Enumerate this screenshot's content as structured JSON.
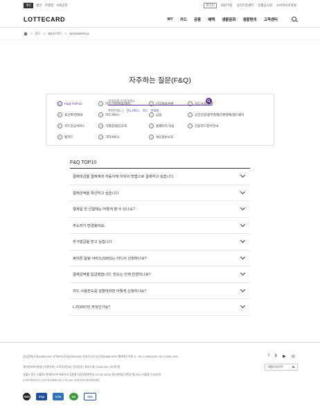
{
  "topbar": {
    "left": [
      "개인",
      "법인",
      "가맹점",
      "사회공헌"
    ],
    "right_box": "로그인",
    "right": [
      "회원가입",
      "공인인증센터",
      "상품공시실",
      "소비자보호포털"
    ]
  },
  "header": {
    "logo": "LOTTECARD",
    "menu": [
      "MY",
      "카드",
      "금융",
      "혜택",
      "생활문화",
      "생활편의",
      "고객센터"
    ]
  },
  "breadcrumb": [
    "카드",
    "BEST카드",
    "WONDERFUL"
  ],
  "page_title": "자주하는 질문(F&Q)",
  "search": {
    "placeholder": "검색어를 입력하세요."
  },
  "recommend": {
    "label": "추천키워드 |",
    "keywords": [
      "한도서비스",
      "카드",
      "연회비"
    ]
  },
  "categories": [
    "F&Q TOP10",
    "카드신청/발급/해지",
    "신상정보변경",
    "카드사용/결제",
    "포인트/연회비",
    "카드서비스",
    "금융",
    "공인인증/할부결제/간편결제/앱드페이",
    "카드안심서비스",
    "가맹점/법인고객",
    "홈페이지 이용",
    "신용카드업무안내",
    "법카드",
    "기타서비스",
    "개인정보보호"
  ],
  "faq": {
    "title": "F&Q TOP10",
    "items": [
      "결제대금을 결제계좌 자동이체 이외의 방법으로 결제하고 싶습니다.",
      "결제금액을 확인하고 싶습니다.",
      "결제일 전 선결제는 어떻게 할 수 있나요?",
      "주소지가 변경됐어요.",
      "추가발급을 받고 싶습니다.",
      "휴대폰 알림 서비스(SMS)는 어디서 신청하나요?",
      "결제금액을 입금했습니다. 한도는 언제 반영되나요?",
      "카드 사용한도를 상향하려면 어떻게 신청하나요?",
      "L.POINT란 무엇인가요?"
    ]
  },
  "footer": {
    "phones": "상담전화(국내)1588-8100      고객ARS(국내)1588-8200      분실/도난신고(국내)1588-8300      해외에서 이용 시 : 82-2-1588-8100 / 82-2-2280-2400",
    "links": "개인정보처리방침  |  이용약관  |  고객권리안내  |  윤리경영  |  회사소개  |  ENGLISH  |  사이트맵",
    "address": "서울시 중구 소월로3   롯데카드㈜ 대표이사 김창권   사업자등록번호 120-81-54231   통신판매신고번호 제-2010-서울중구-0087호",
    "copyright": "COPYRIGHT© LOTTECARD CO.,LTD. ALL RIGHTS RESERVED.",
    "social": [
      "f",
      "b",
      "▶",
      "◎"
    ],
    "family_site": "패밀리사이트",
    "certs": [
      "ISMS",
      "KSQI",
      "KCSI",
      "WA",
      "SDA"
    ]
  }
}
